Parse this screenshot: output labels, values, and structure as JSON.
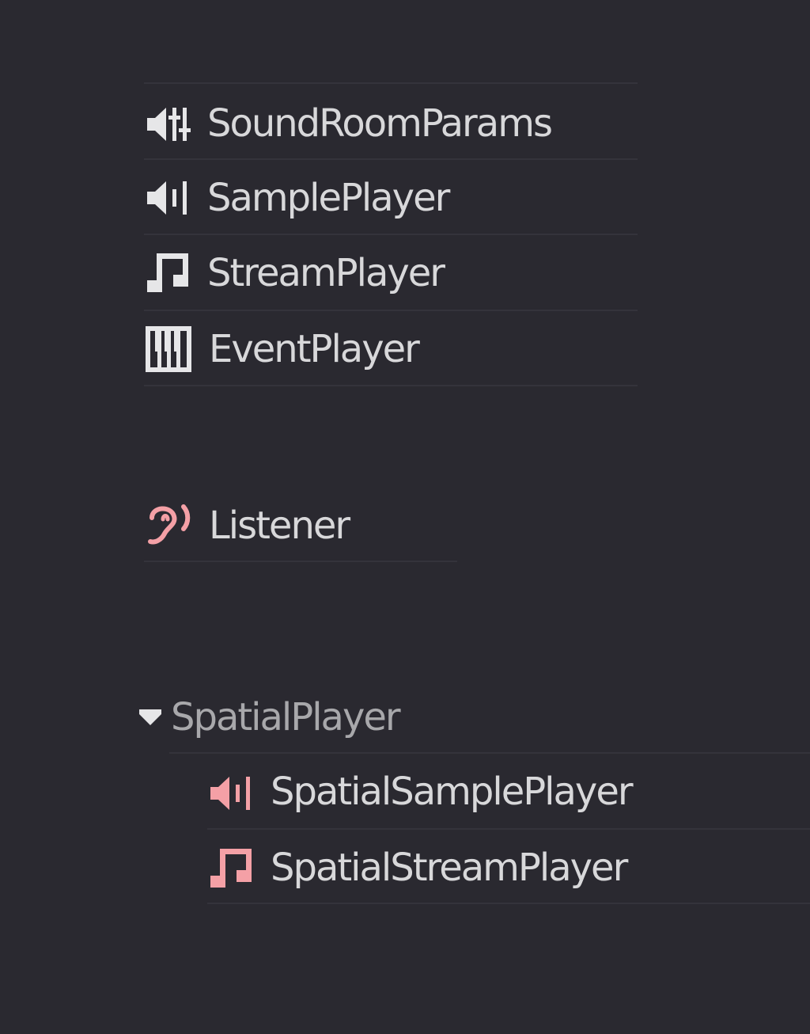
{
  "colors": {
    "background": "#2a2930",
    "text": "#d8d8da",
    "group_text": "#a8a8ab",
    "icon_white": "#e6e6e8",
    "icon_pink": "#f4a0a6",
    "separator": "#34333b"
  },
  "tree": {
    "players": [
      {
        "label": "SoundRoomParams",
        "icon": "speaker-params-icon"
      },
      {
        "label": "SamplePlayer",
        "icon": "speaker-icon"
      },
      {
        "label": "StreamPlayer",
        "icon": "music-note-icon"
      },
      {
        "label": "EventPlayer",
        "icon": "piano-keys-icon"
      }
    ],
    "listener": {
      "label": "Listener",
      "icon": "ear-icon"
    },
    "spatial_group": {
      "label": "SpatialPlayer",
      "expand_icon": "triangle-down-icon",
      "children": [
        {
          "label": "SpatialSamplePlayer",
          "icon": "speaker-icon"
        },
        {
          "label": "SpatialStreamPlayer",
          "icon": "music-note-icon"
        }
      ]
    }
  }
}
